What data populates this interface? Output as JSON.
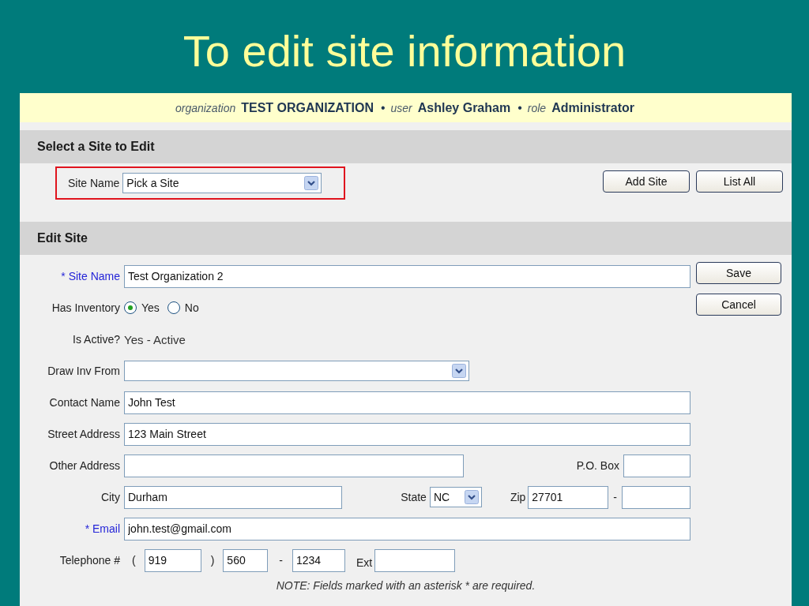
{
  "slide_title": "To edit site information",
  "context_bar": [
    {
      "kind": "label",
      "text": "organization"
    },
    {
      "kind": "value",
      "text": "TEST ORGANIZATION"
    },
    {
      "kind": "separator",
      "text": "•"
    },
    {
      "kind": "label",
      "text": "user"
    },
    {
      "kind": "value",
      "text": "Ashley Graham"
    },
    {
      "kind": "separator",
      "text": "•"
    },
    {
      "kind": "label",
      "text": "role"
    },
    {
      "kind": "value",
      "text": "Administrator"
    }
  ],
  "select_section": {
    "title": "Select a Site to Edit",
    "label": "Site Name",
    "select_value": "Pick a Site",
    "highlighted": true,
    "buttons": [
      "Add Site",
      "List All"
    ]
  },
  "edit_section": {
    "title": "Edit Site",
    "rows": [
      {
        "kind": "text_field",
        "label": "* Site Name",
        "required": true,
        "value": "Test Organization 2",
        "button": "Save"
      },
      {
        "kind": "radio",
        "label": "Has Inventory",
        "options": [
          {
            "label": "Yes",
            "selected": true
          },
          {
            "label": "No",
            "selected": false
          }
        ],
        "button": "Cancel"
      },
      {
        "kind": "static",
        "label": "Is Active?",
        "value": "Yes - Active"
      },
      {
        "kind": "select",
        "label": "Draw Inv From",
        "value": ""
      },
      {
        "kind": "text_field",
        "label": "Contact Name",
        "required": false,
        "value": "John Test"
      },
      {
        "kind": "text_field",
        "label": "Street Address",
        "required": false,
        "value": "123 Main Street"
      },
      {
        "kind": "other_address",
        "label": "Other Address",
        "value": "",
        "po_label": "P.O. Box",
        "po_value": ""
      },
      {
        "kind": "city",
        "label": "City",
        "value": "Durham",
        "state_label": "State",
        "state_value": "NC",
        "zip_label": "Zip",
        "zip_value": "27701",
        "zip_sep": "-",
        "zip4_value": ""
      },
      {
        "kind": "text_field",
        "label": "* Email",
        "required": true,
        "value": "john.test@gmail.com"
      },
      {
        "kind": "phone",
        "label": "Telephone #",
        "open": "(",
        "area": "919",
        "close": ")",
        "prefix": "560",
        "dash": "-",
        "line": "1234",
        "ext_label": "Ext",
        "ext": ""
      }
    ],
    "note": "NOTE: Fields marked with an asterisk * are required."
  }
}
